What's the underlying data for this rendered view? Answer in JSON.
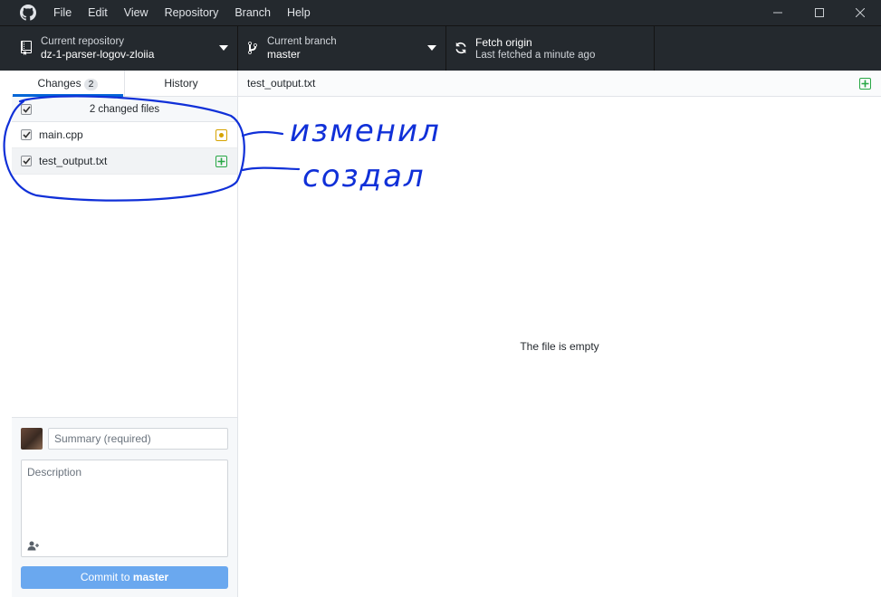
{
  "menu": [
    "File",
    "Edit",
    "View",
    "Repository",
    "Branch",
    "Help"
  ],
  "toolbar": {
    "repo_label": "Current repository",
    "repo_value": "dz-1-parser-logov-zloiia",
    "branch_label": "Current branch",
    "branch_value": "master",
    "fetch_label": "Fetch origin",
    "fetch_value": "Last fetched a minute ago"
  },
  "tabs": {
    "changes_label": "Changes",
    "changes_count": "2",
    "history_label": "History"
  },
  "files": {
    "summary": "2 changed files",
    "items": [
      {
        "name": "main.cpp",
        "status": "modified"
      },
      {
        "name": "test_output.txt",
        "status": "added"
      }
    ]
  },
  "commit": {
    "summary_placeholder": "Summary (required)",
    "description_placeholder": "Description",
    "button_prefix": "Commit to ",
    "button_branch": "master"
  },
  "diff": {
    "path": "test_output.txt",
    "empty_message": "The file is empty"
  },
  "annotations": {
    "modified_note": "изменил",
    "created_note": "создал"
  },
  "colors": {
    "titlebar": "#24292e",
    "accent": "#0366d6",
    "commit_button": "#6aa8ef",
    "modified": "#d6a300",
    "added": "#28a745",
    "annotation_ink": "#1030d8"
  }
}
